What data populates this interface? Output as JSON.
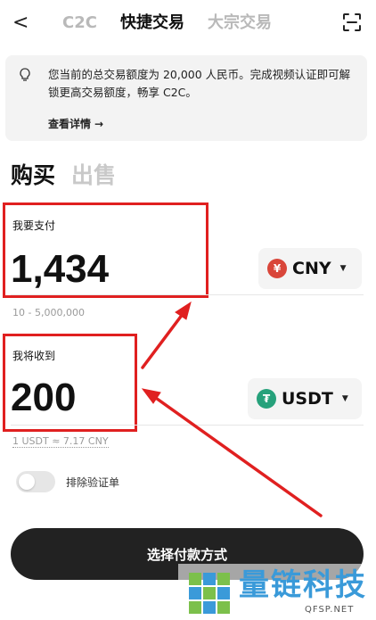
{
  "header": {
    "back": "<",
    "tabs": [
      "C2C",
      "快捷交易",
      "大宗交易"
    ],
    "active_tab": "快捷交易"
  },
  "notice": {
    "text": "您当前的总交易额度为 20,000 人民币。完成视频认证即可解锁更高交易额度，畅享 C2C。",
    "more": "查看详情",
    "more_arrow": "→"
  },
  "mode": {
    "buy": "购买",
    "sell": "出售"
  },
  "pay": {
    "label": "我要支付",
    "amount": "1,434",
    "currency": "CNY",
    "currency_symbol": "¥",
    "currency_color": "#d9463a",
    "hint": "10 - 5,000,000"
  },
  "receive": {
    "label": "我将收到",
    "amount": "200",
    "currency": "USDT",
    "currency_symbol": "₮",
    "currency_color": "#26a17b",
    "rate": "1 USDT ≈ 7.17 CNY"
  },
  "toggle": {
    "label": "排除验证单",
    "on": false
  },
  "cta": {
    "label": "选择付款方式"
  },
  "watermark": {
    "text": "量链科技",
    "sub": "QFSP.NET",
    "color": "#3a9ad9"
  },
  "annotation": {
    "color": "#e02020"
  }
}
